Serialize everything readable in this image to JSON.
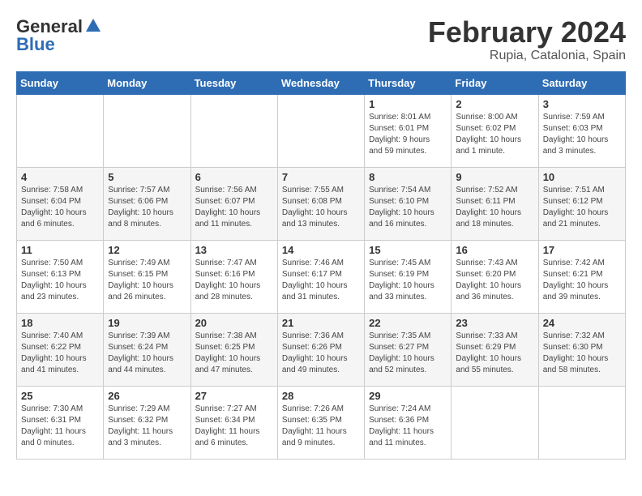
{
  "logo": {
    "general": "General",
    "blue": "Blue"
  },
  "header": {
    "month": "February 2024",
    "location": "Rupia, Catalonia, Spain"
  },
  "days_of_week": [
    "Sunday",
    "Monday",
    "Tuesday",
    "Wednesday",
    "Thursday",
    "Friday",
    "Saturday"
  ],
  "weeks": [
    [
      {
        "day": "",
        "info": ""
      },
      {
        "day": "",
        "info": ""
      },
      {
        "day": "",
        "info": ""
      },
      {
        "day": "",
        "info": ""
      },
      {
        "day": "1",
        "info": "Sunrise: 8:01 AM\nSunset: 6:01 PM\nDaylight: 9 hours\nand 59 minutes."
      },
      {
        "day": "2",
        "info": "Sunrise: 8:00 AM\nSunset: 6:02 PM\nDaylight: 10 hours\nand 1 minute."
      },
      {
        "day": "3",
        "info": "Sunrise: 7:59 AM\nSunset: 6:03 PM\nDaylight: 10 hours\nand 3 minutes."
      }
    ],
    [
      {
        "day": "4",
        "info": "Sunrise: 7:58 AM\nSunset: 6:04 PM\nDaylight: 10 hours\nand 6 minutes."
      },
      {
        "day": "5",
        "info": "Sunrise: 7:57 AM\nSunset: 6:06 PM\nDaylight: 10 hours\nand 8 minutes."
      },
      {
        "day": "6",
        "info": "Sunrise: 7:56 AM\nSunset: 6:07 PM\nDaylight: 10 hours\nand 11 minutes."
      },
      {
        "day": "7",
        "info": "Sunrise: 7:55 AM\nSunset: 6:08 PM\nDaylight: 10 hours\nand 13 minutes."
      },
      {
        "day": "8",
        "info": "Sunrise: 7:54 AM\nSunset: 6:10 PM\nDaylight: 10 hours\nand 16 minutes."
      },
      {
        "day": "9",
        "info": "Sunrise: 7:52 AM\nSunset: 6:11 PM\nDaylight: 10 hours\nand 18 minutes."
      },
      {
        "day": "10",
        "info": "Sunrise: 7:51 AM\nSunset: 6:12 PM\nDaylight: 10 hours\nand 21 minutes."
      }
    ],
    [
      {
        "day": "11",
        "info": "Sunrise: 7:50 AM\nSunset: 6:13 PM\nDaylight: 10 hours\nand 23 minutes."
      },
      {
        "day": "12",
        "info": "Sunrise: 7:49 AM\nSunset: 6:15 PM\nDaylight: 10 hours\nand 26 minutes."
      },
      {
        "day": "13",
        "info": "Sunrise: 7:47 AM\nSunset: 6:16 PM\nDaylight: 10 hours\nand 28 minutes."
      },
      {
        "day": "14",
        "info": "Sunrise: 7:46 AM\nSunset: 6:17 PM\nDaylight: 10 hours\nand 31 minutes."
      },
      {
        "day": "15",
        "info": "Sunrise: 7:45 AM\nSunset: 6:19 PM\nDaylight: 10 hours\nand 33 minutes."
      },
      {
        "day": "16",
        "info": "Sunrise: 7:43 AM\nSunset: 6:20 PM\nDaylight: 10 hours\nand 36 minutes."
      },
      {
        "day": "17",
        "info": "Sunrise: 7:42 AM\nSunset: 6:21 PM\nDaylight: 10 hours\nand 39 minutes."
      }
    ],
    [
      {
        "day": "18",
        "info": "Sunrise: 7:40 AM\nSunset: 6:22 PM\nDaylight: 10 hours\nand 41 minutes."
      },
      {
        "day": "19",
        "info": "Sunrise: 7:39 AM\nSunset: 6:24 PM\nDaylight: 10 hours\nand 44 minutes."
      },
      {
        "day": "20",
        "info": "Sunrise: 7:38 AM\nSunset: 6:25 PM\nDaylight: 10 hours\nand 47 minutes."
      },
      {
        "day": "21",
        "info": "Sunrise: 7:36 AM\nSunset: 6:26 PM\nDaylight: 10 hours\nand 49 minutes."
      },
      {
        "day": "22",
        "info": "Sunrise: 7:35 AM\nSunset: 6:27 PM\nDaylight: 10 hours\nand 52 minutes."
      },
      {
        "day": "23",
        "info": "Sunrise: 7:33 AM\nSunset: 6:29 PM\nDaylight: 10 hours\nand 55 minutes."
      },
      {
        "day": "24",
        "info": "Sunrise: 7:32 AM\nSunset: 6:30 PM\nDaylight: 10 hours\nand 58 minutes."
      }
    ],
    [
      {
        "day": "25",
        "info": "Sunrise: 7:30 AM\nSunset: 6:31 PM\nDaylight: 11 hours\nand 0 minutes."
      },
      {
        "day": "26",
        "info": "Sunrise: 7:29 AM\nSunset: 6:32 PM\nDaylight: 11 hours\nand 3 minutes."
      },
      {
        "day": "27",
        "info": "Sunrise: 7:27 AM\nSunset: 6:34 PM\nDaylight: 11 hours\nand 6 minutes."
      },
      {
        "day": "28",
        "info": "Sunrise: 7:26 AM\nSunset: 6:35 PM\nDaylight: 11 hours\nand 9 minutes."
      },
      {
        "day": "29",
        "info": "Sunrise: 7:24 AM\nSunset: 6:36 PM\nDaylight: 11 hours\nand 11 minutes."
      },
      {
        "day": "",
        "info": ""
      },
      {
        "day": "",
        "info": ""
      }
    ]
  ]
}
